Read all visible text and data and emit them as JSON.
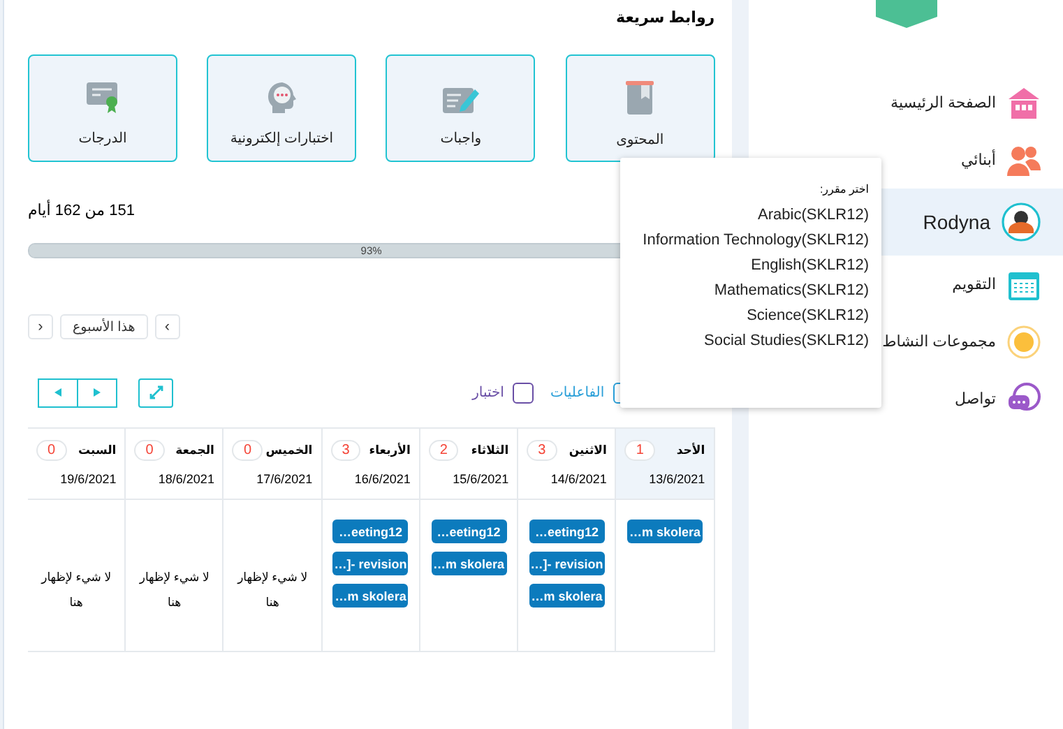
{
  "quick_links": {
    "title": "روابط سريعة",
    "items": [
      {
        "label": "المحتوى"
      },
      {
        "label": "واجبات"
      },
      {
        "label": "اختبارات إلكترونية"
      },
      {
        "label": "الدرجات"
      }
    ]
  },
  "progress": {
    "text": "151 من 162 أيام",
    "level": 0.93,
    "label": "93%"
  },
  "week_nav": {
    "next": "›",
    "label": "هذا الأسبوع",
    "prev": "‹"
  },
  "legend": [
    {
      "label": "الفاعليات",
      "checked": false,
      "color": "#2a9fd8"
    },
    {
      "label": "اختبار",
      "checked": false,
      "color": "#6a4fa6"
    }
  ],
  "calendar": {
    "days": [
      {
        "name": "الأحد",
        "count": "1",
        "date": "13/6/2021",
        "today": true,
        "events": [
          "…m skolera"
        ]
      },
      {
        "name": "الاثنين",
        "count": "3",
        "date": "14/6/2021",
        "today": false,
        "events": [
          "…eeting12",
          "…]- revision",
          "…m skolera"
        ]
      },
      {
        "name": "الثلاثاء",
        "count": "2",
        "date": "15/6/2021",
        "today": false,
        "events": [
          "…eeting12",
          "…m skolera"
        ]
      },
      {
        "name": "الأربعاء",
        "count": "3",
        "date": "16/6/2021",
        "today": false,
        "events": [
          "…eeting12",
          "…]- revision",
          "…m skolera"
        ]
      },
      {
        "name": "الخميس",
        "count": "0",
        "date": "17/6/2021",
        "today": false,
        "empty_text": "لا شيء لإظهار هنا"
      },
      {
        "name": "الجمعة",
        "count": "0",
        "date": "18/6/2021",
        "today": false,
        "empty_text": "لا شيء لإظهار هنا"
      },
      {
        "name": "السبت",
        "count": "0",
        "date": "19/6/2021",
        "today": false,
        "empty_text": "لا شيء لإظهار هنا"
      }
    ]
  },
  "popover": {
    "title": "اختر مقرر:",
    "courses": [
      "Arabic(SKLR12)",
      "Information Technology(SKLR12)",
      "English(SKLR12)",
      "Mathematics(SKLR12)",
      "Science(SKLR12)",
      "Social Studies(SKLR12)"
    ]
  },
  "sidebar": {
    "items": [
      {
        "label": "الصفحة الرئيسية",
        "selected": false
      },
      {
        "label": "أبنائي",
        "selected": false
      },
      {
        "label": "Rodyna",
        "selected": true
      },
      {
        "label": "التقويم",
        "selected": false
      },
      {
        "label": "مجموعات النشاط",
        "selected": false
      },
      {
        "label": "تواصل",
        "selected": false
      }
    ]
  }
}
